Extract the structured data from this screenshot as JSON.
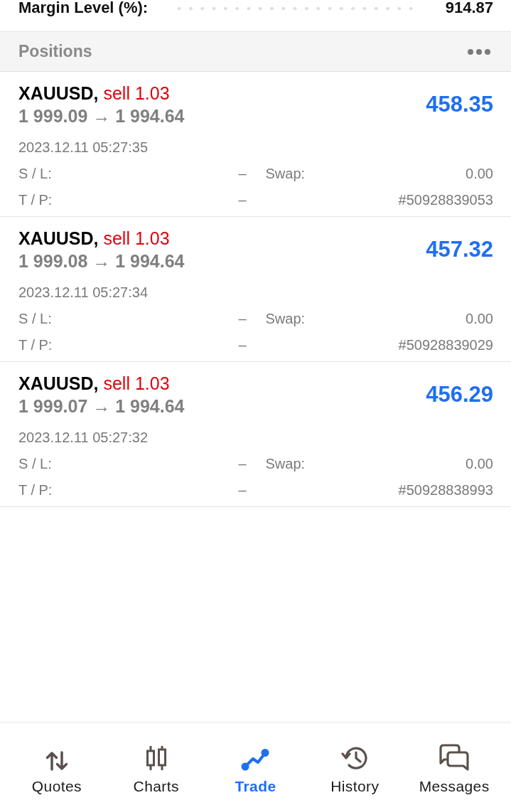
{
  "account_summary": {
    "label": "Margin Level (%):",
    "value": "914.87"
  },
  "positions_header": {
    "title": "Positions"
  },
  "positions": [
    {
      "symbol": "XAUUSD,",
      "side": "sell",
      "volume": "1.03",
      "prices": "1 999.09 → 1 994.64",
      "profit": "458.35",
      "time": "2023.12.11 05:27:35",
      "sl_label": "S / L:",
      "sl": "–",
      "swap_label": "Swap:",
      "swap": "0.00",
      "tp_label": "T / P:",
      "tp": "–",
      "ticket": "#50928839053"
    },
    {
      "symbol": "XAUUSD,",
      "side": "sell",
      "volume": "1.03",
      "prices": "1 999.08 → 1 994.64",
      "profit": "457.32",
      "time": "2023.12.11 05:27:34",
      "sl_label": "S / L:",
      "sl": "–",
      "swap_label": "Swap:",
      "swap": "0.00",
      "tp_label": "T / P:",
      "tp": "–",
      "ticket": "#50928839029"
    },
    {
      "symbol": "XAUUSD,",
      "side": "sell",
      "volume": "1.03",
      "prices": "1 999.07 → 1 994.64",
      "profit": "456.29",
      "time": "2023.12.11 05:27:32",
      "sl_label": "S / L:",
      "sl": "–",
      "swap_label": "Swap:",
      "swap": "0.00",
      "tp_label": "T / P:",
      "tp": "–",
      "ticket": "#50928838993"
    }
  ],
  "bottom_nav": {
    "items": [
      {
        "label": "Quotes",
        "selected": false
      },
      {
        "label": "Charts",
        "selected": false
      },
      {
        "label": "Trade",
        "selected": true
      },
      {
        "label": "History",
        "selected": false
      },
      {
        "label": "Messages",
        "selected": false
      }
    ]
  }
}
